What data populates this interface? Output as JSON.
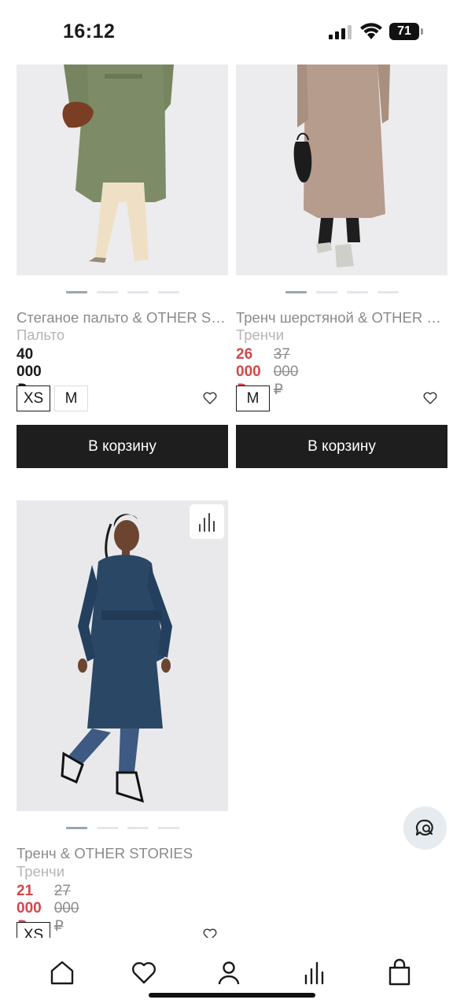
{
  "status_bar": {
    "time": "16:12",
    "battery": "71"
  },
  "products": [
    {
      "title": "Стеганое пальто & OTHER STORIES",
      "category": "Пальто",
      "price": "40 000 ₽",
      "old_price": "",
      "sizes": [
        "XS",
        "M"
      ],
      "cart_label": "В корзину",
      "coat_color": "#7d8c67"
    },
    {
      "title": "Тренч шерстяной & OTHER STORIES",
      "category": "Тренчи",
      "price": "26 000 ₽",
      "old_price": "37 000 ₽",
      "sizes": [
        "M"
      ],
      "cart_label": "В корзину",
      "coat_color": "#b59c8d"
    },
    {
      "title": "Тренч & OTHER STORIES",
      "category": "Тренчи",
      "price": "21 000 ₽",
      "old_price": "27 000 ₽",
      "sizes": [
        "XS"
      ],
      "coat_color": "#2a4766"
    }
  ],
  "colors": {
    "sale_price": "#d3474b",
    "button_bg": "#1e1e1e",
    "image_bg": "#ebebed"
  },
  "icons": {
    "tab_bar": [
      "home-icon",
      "heart-icon",
      "profile-icon",
      "compare-icon",
      "cart-icon"
    ],
    "fab": "chat-search-icon",
    "badge": "compare-icon"
  }
}
